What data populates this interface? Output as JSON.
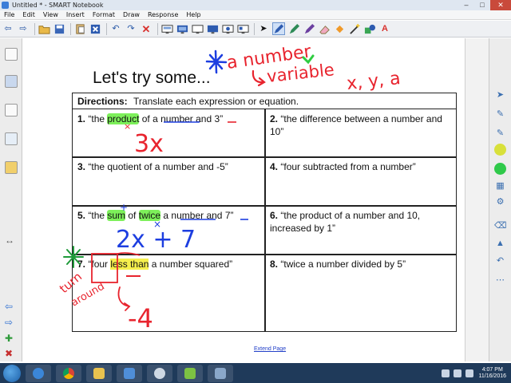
{
  "window": {
    "title": "Untitled * - SMART Notebook"
  },
  "menu": {
    "items": [
      "File",
      "Edit",
      "View",
      "Insert",
      "Format",
      "Draw",
      "Response",
      "Help"
    ]
  },
  "toolbar": {
    "icons": [
      "back-arrow-icon",
      "forward-arrow-icon",
      "open-folder-icon",
      "save-icon",
      "paste-icon",
      "delete-icon",
      "undo-icon",
      "redo-icon",
      "close-x-icon",
      "screen-shade-icon",
      "table-icon",
      "display-icon",
      "monitor-icon",
      "document-camera-icon",
      "full-screen-icon",
      "pointer-icon",
      "pen-icon",
      "highlighter-pen-icon",
      "creative-pen-icon",
      "eraser-icon",
      "fill-icon",
      "magic-pen-icon",
      "shapes-icon",
      "text-icon"
    ]
  },
  "page": {
    "heading": "Let's try some...",
    "extend_label": "Extend Page",
    "directions_label": "Directions:",
    "directions_text": "Translate each expression or equation.",
    "items": [
      {
        "num": "1.",
        "pre": "“the ",
        "h1": "product",
        "mid": " of ",
        "u1": "a number",
        "and": " and ",
        "u2": "3",
        "post": "”"
      },
      {
        "num": "2.",
        "text": "“the difference between a number and 10”"
      },
      {
        "num": "3.",
        "text": "“the quotient of a number and -5”"
      },
      {
        "num": "4.",
        "text": "“four subtracted from a number”"
      },
      {
        "num": "5.",
        "pre": "“the ",
        "h1": "sum",
        "mid": " of ",
        "h2": "twice",
        "sp": " ",
        "u1": "a number",
        "and": " and ",
        "u2": "7",
        "post": "”"
      },
      {
        "num": "6.",
        "text": "“the product of a number and 10, increased by 1”"
      },
      {
        "num": "7.",
        "pre": "“",
        "w1": "four",
        "sp": " ",
        "h1": "less than",
        "post": " a number squared”"
      },
      {
        "num": "8.",
        "text": "“twice a number divided by 5”"
      }
    ]
  },
  "annotations": {
    "a_number": "a number",
    "variable": "variable",
    "xya": "x, y, a",
    "ans1": "3x",
    "ans5": "2x + 7",
    "ans7": "-4",
    "turn": "turn",
    "around": "around"
  },
  "taskbar": {
    "time": "4:07 PM",
    "date": "11/16/2016"
  },
  "colors": {
    "ink_red": "#e8242e",
    "ink_blue": "#1d3ee0",
    "ink_green": "#1f9a3a",
    "highlight_green": "#7df05a",
    "highlight_yellow": "#f6f04d"
  }
}
